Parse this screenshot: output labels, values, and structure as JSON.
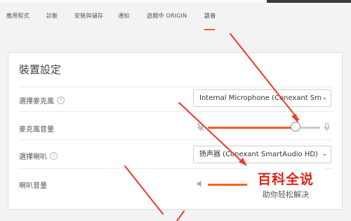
{
  "tabs": [
    {
      "label": "應用程式"
    },
    {
      "label": "診斷"
    },
    {
      "label": "安裝與儲存"
    },
    {
      "label": "通知"
    },
    {
      "label": "遊戲中 ORIGIN"
    },
    {
      "label": "語音"
    }
  ],
  "active_tab": "語音",
  "section": {
    "title": "裝置設定",
    "rows": [
      {
        "label": "選擇麥克風",
        "value": "Internal Microphone (Conexant Sm"
      },
      {
        "label": "麥克風音量",
        "level_percent": 78
      },
      {
        "label": "選擇喇叭",
        "value": "扬声器 (Conexant SmartAudio HD)"
      },
      {
        "label": "喇叭音量"
      }
    ]
  },
  "watermark": {
    "title": "百科全说",
    "subtitle": "助你轻松解决"
  },
  "colors": {
    "accent": "#f25d22",
    "arrow": "#ee3b2b",
    "watermark_red": "#d9291c"
  },
  "icons": {
    "help": "?",
    "chevron": "❯"
  }
}
